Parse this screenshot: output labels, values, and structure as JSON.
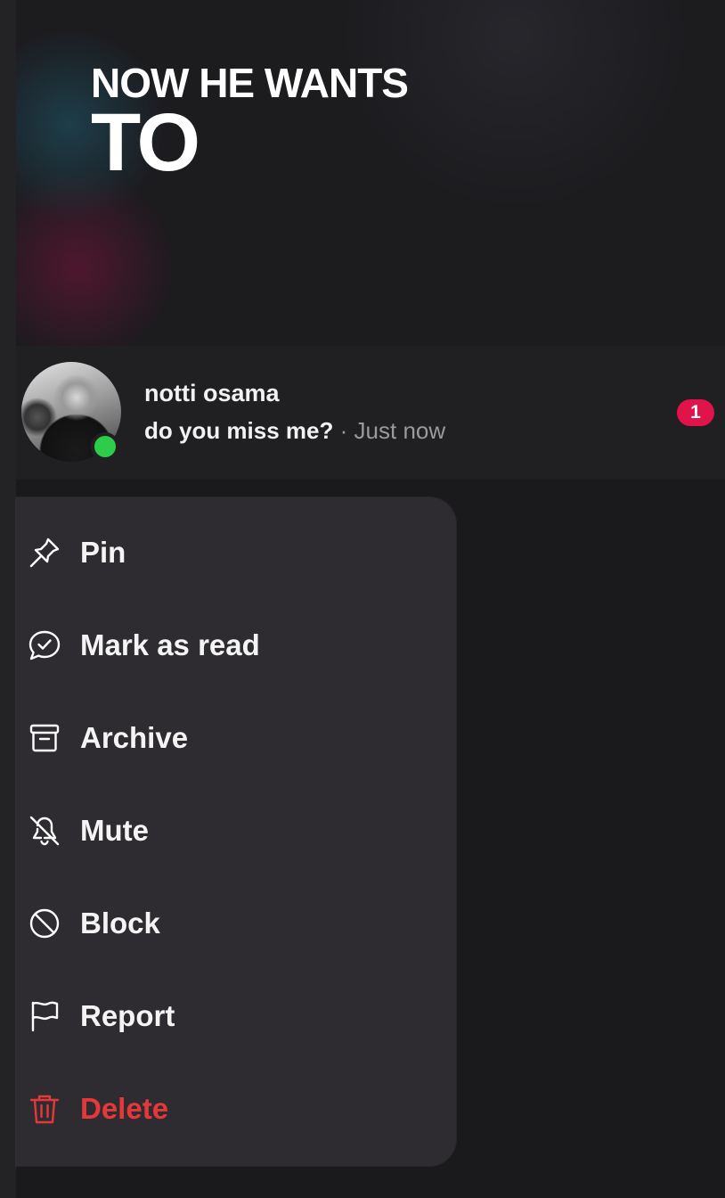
{
  "video_caption": {
    "line1": "NOW HE WANTS",
    "line2": "TO"
  },
  "chat": {
    "name": "notti osama",
    "message": "do you miss me?",
    "separator": "·",
    "time": "Just now",
    "unread_count": "1",
    "online": true,
    "online_color": "#2dcc4a",
    "badge_color": "#e0134a"
  },
  "context_menu": {
    "items": [
      {
        "label": "Pin",
        "icon": "pin-icon"
      },
      {
        "label": "Mark as read",
        "icon": "mark-read-icon"
      },
      {
        "label": "Archive",
        "icon": "archive-icon"
      },
      {
        "label": "Mute",
        "icon": "bell-off-icon"
      },
      {
        "label": "Block",
        "icon": "block-icon"
      },
      {
        "label": "Report",
        "icon": "flag-icon"
      },
      {
        "label": "Delete",
        "icon": "trash-icon",
        "danger": true,
        "color": "#e5383b"
      }
    ]
  }
}
